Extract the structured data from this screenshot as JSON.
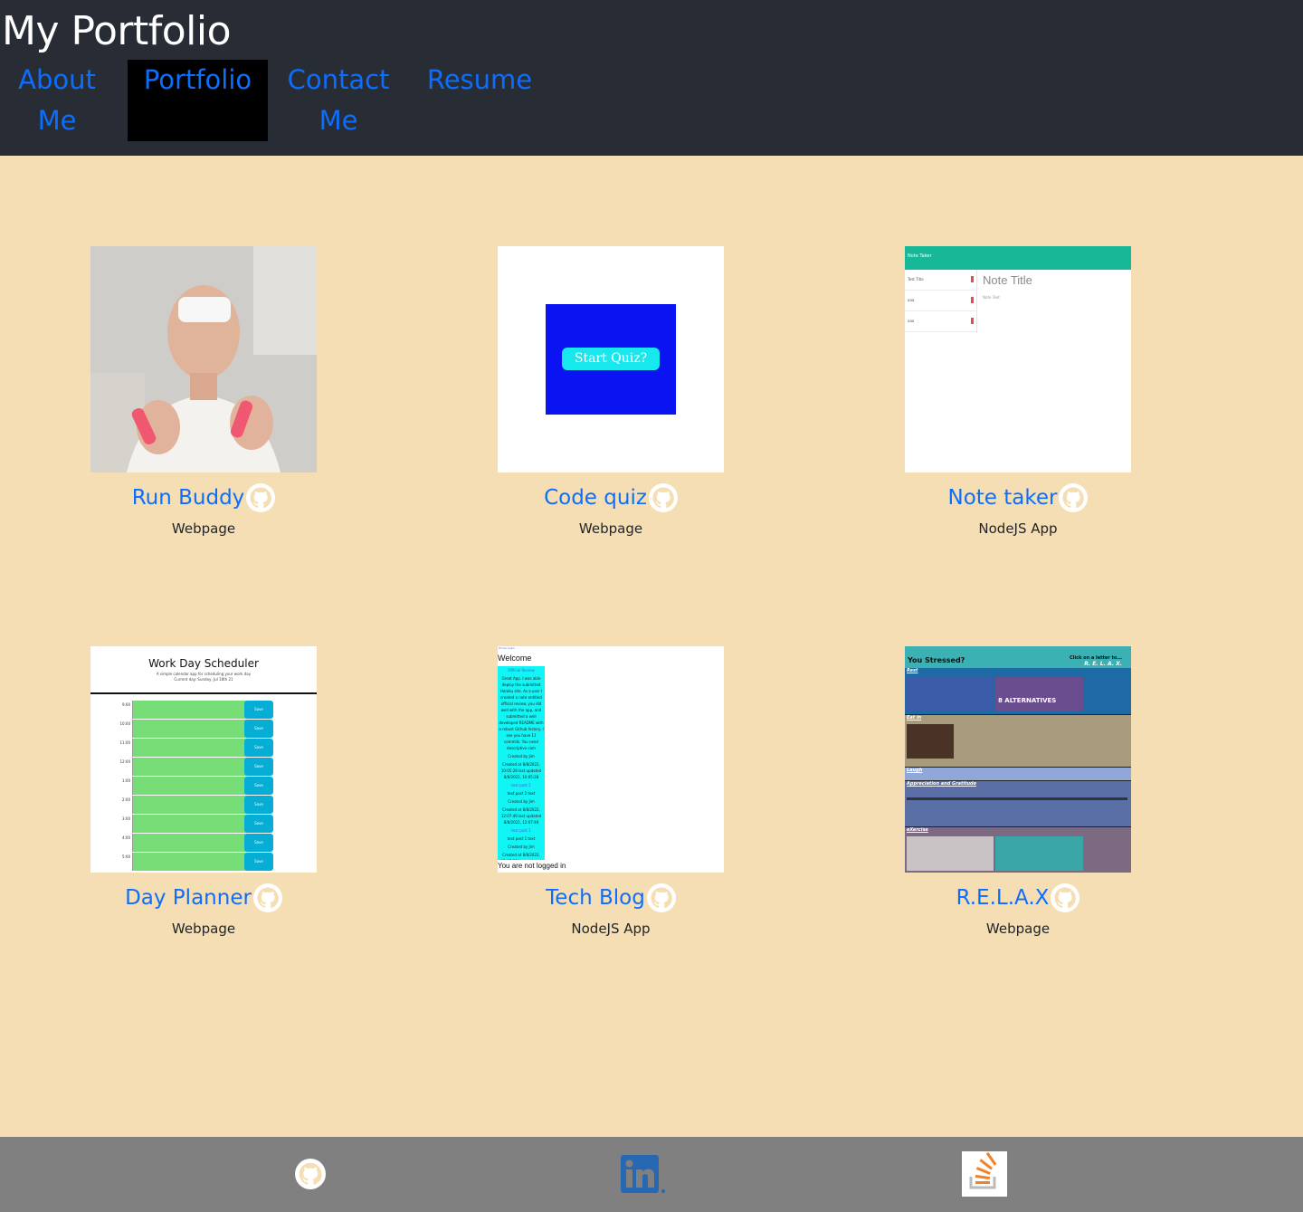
{
  "header": {
    "title": "My Portfolio",
    "nav": {
      "about": [
        "About",
        "Me"
      ],
      "portfolio": "Portfolio",
      "contact": [
        "Contact",
        "Me"
      ],
      "resume": "Resume"
    },
    "active_nav": "Portfolio"
  },
  "projects": [
    {
      "title": "Run Buddy",
      "type": "Webpage",
      "icon": "github-icon"
    },
    {
      "title": "Code quiz",
      "type": "Webpage",
      "icon": "github-icon"
    },
    {
      "title": "Note taker",
      "type": "NodeJS App",
      "icon": "github-icon"
    },
    {
      "title": "Day Planner",
      "type": "Webpage",
      "icon": "github-icon"
    },
    {
      "title": "Tech Blog",
      "type": "NodeJS App",
      "icon": "github-icon"
    },
    {
      "title": "R.E.L.A.X",
      "type": "Webpage",
      "icon": "github-icon"
    }
  ],
  "thumbnails": {
    "quiz": {
      "button": "Start Quiz?"
    },
    "note": {
      "bar": "Note Taker",
      "main_title": "Note Title",
      "main_sub": "Note Text",
      "items": [
        "Test Title",
        "aaa",
        "aaa"
      ]
    },
    "planner": {
      "title": "Work Day Scheduler",
      "sub1": "A simple calendar app for scheduling your work day",
      "sub2": "Current day: Sunday, Jul 18th 21",
      "hours": [
        "9:00",
        "10:00",
        "11:00",
        "12:00",
        "1:00",
        "2:00",
        "3:00",
        "4:00",
        "5:00"
      ],
      "save": "Save"
    },
    "blog": {
      "top": "Home Login",
      "welcome": "Welcome",
      "posts": [
        "Official Review",
        "Great App. I was able deploy the submitted Heroku site. As a user I created a note entitled official review. you did well with the app, and submitted a well developed README with a robust Github history. I see you have 11 commits. You need descriptive com",
        "Created by Jim",
        "Created at 8/8/2022, 10:05:28 last updated 8/8/2022, 10:05:28",
        "test post 2",
        "test post 2 text",
        "Created by Jim",
        "Created at 8/8/2022, 12:07:49 last updated 8/8/2022, 12:07:49",
        "test post 1",
        "test post 1 text",
        "Created by Jim",
        "Created at 8/8/2022, 12:07:36 last updated 8/8/2022, 12:07:36"
      ],
      "footer": "You are not logged in"
    },
    "relax": {
      "heading": "You Stressed?",
      "cta": "Click on a letter to...",
      "letters": "R. E. L. A. X.",
      "sections": [
        "Rest",
        "Eat in",
        "Laugh",
        "Appreciation and Gratitude",
        "eXercise"
      ],
      "video_caption": "8 ALTERNATIVES"
    }
  },
  "footer": {
    "links": [
      "github-icon",
      "linkedin-icon",
      "stack-overflow-icon"
    ]
  },
  "colors": {
    "header_bg": "#282c34",
    "page_bg": "#f5deb3",
    "link": "#0d6efd",
    "footer_bg": "#808080"
  }
}
